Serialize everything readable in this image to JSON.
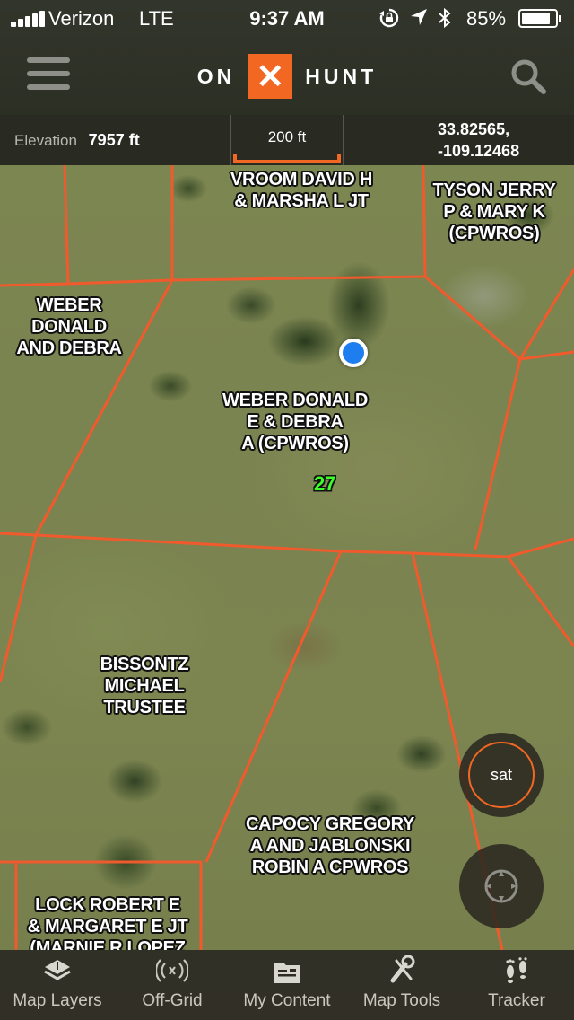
{
  "status_bar": {
    "carrier": "Verizon",
    "network": "LTE",
    "time": "9:37 AM",
    "battery_percent": "85%",
    "battery_level": 0.85
  },
  "header": {
    "logo_left": "ON",
    "logo_mark": "✕",
    "logo_right": "HUNT",
    "brand_color": "#f26722"
  },
  "info_bar": {
    "elevation_label": "Elevation",
    "elevation_value": "7957 ft",
    "scale_label": "200 ft",
    "latitude": "33.82565,",
    "longitude": "-109.12468"
  },
  "map": {
    "parcel_line_color": "#f05a2c",
    "section_number": "27",
    "parcels": [
      "VROOM DAVID H\n& MARSHA L JT",
      "TYSON JERRY\nP & MARY K\n(CPWROS)",
      "WEBER\nDONALD\nAND DEBRA",
      "WEBER DONALD\nE & DEBRA\nA (CPWROS)",
      "BISSONTZ\nMICHAEL\nTRUSTEE",
      "CAPOCY GREGORY\nA AND JABLONSKI\nROBIN A CPWROS",
      "LOCK ROBERT E\n& MARGARET E JT\n(MARNIE R LOPEZ"
    ]
  },
  "controls": {
    "sat_label": "sat",
    "gps_icon": "crosshair-icon"
  },
  "tabs": [
    {
      "label": "Map Layers",
      "icon": "layers-icon"
    },
    {
      "label": "Off-Grid",
      "icon": "broadcast-icon"
    },
    {
      "label": "My Content",
      "icon": "folder-icon"
    },
    {
      "label": "Map Tools",
      "icon": "tools-icon"
    },
    {
      "label": "Tracker",
      "icon": "footprints-icon"
    }
  ]
}
